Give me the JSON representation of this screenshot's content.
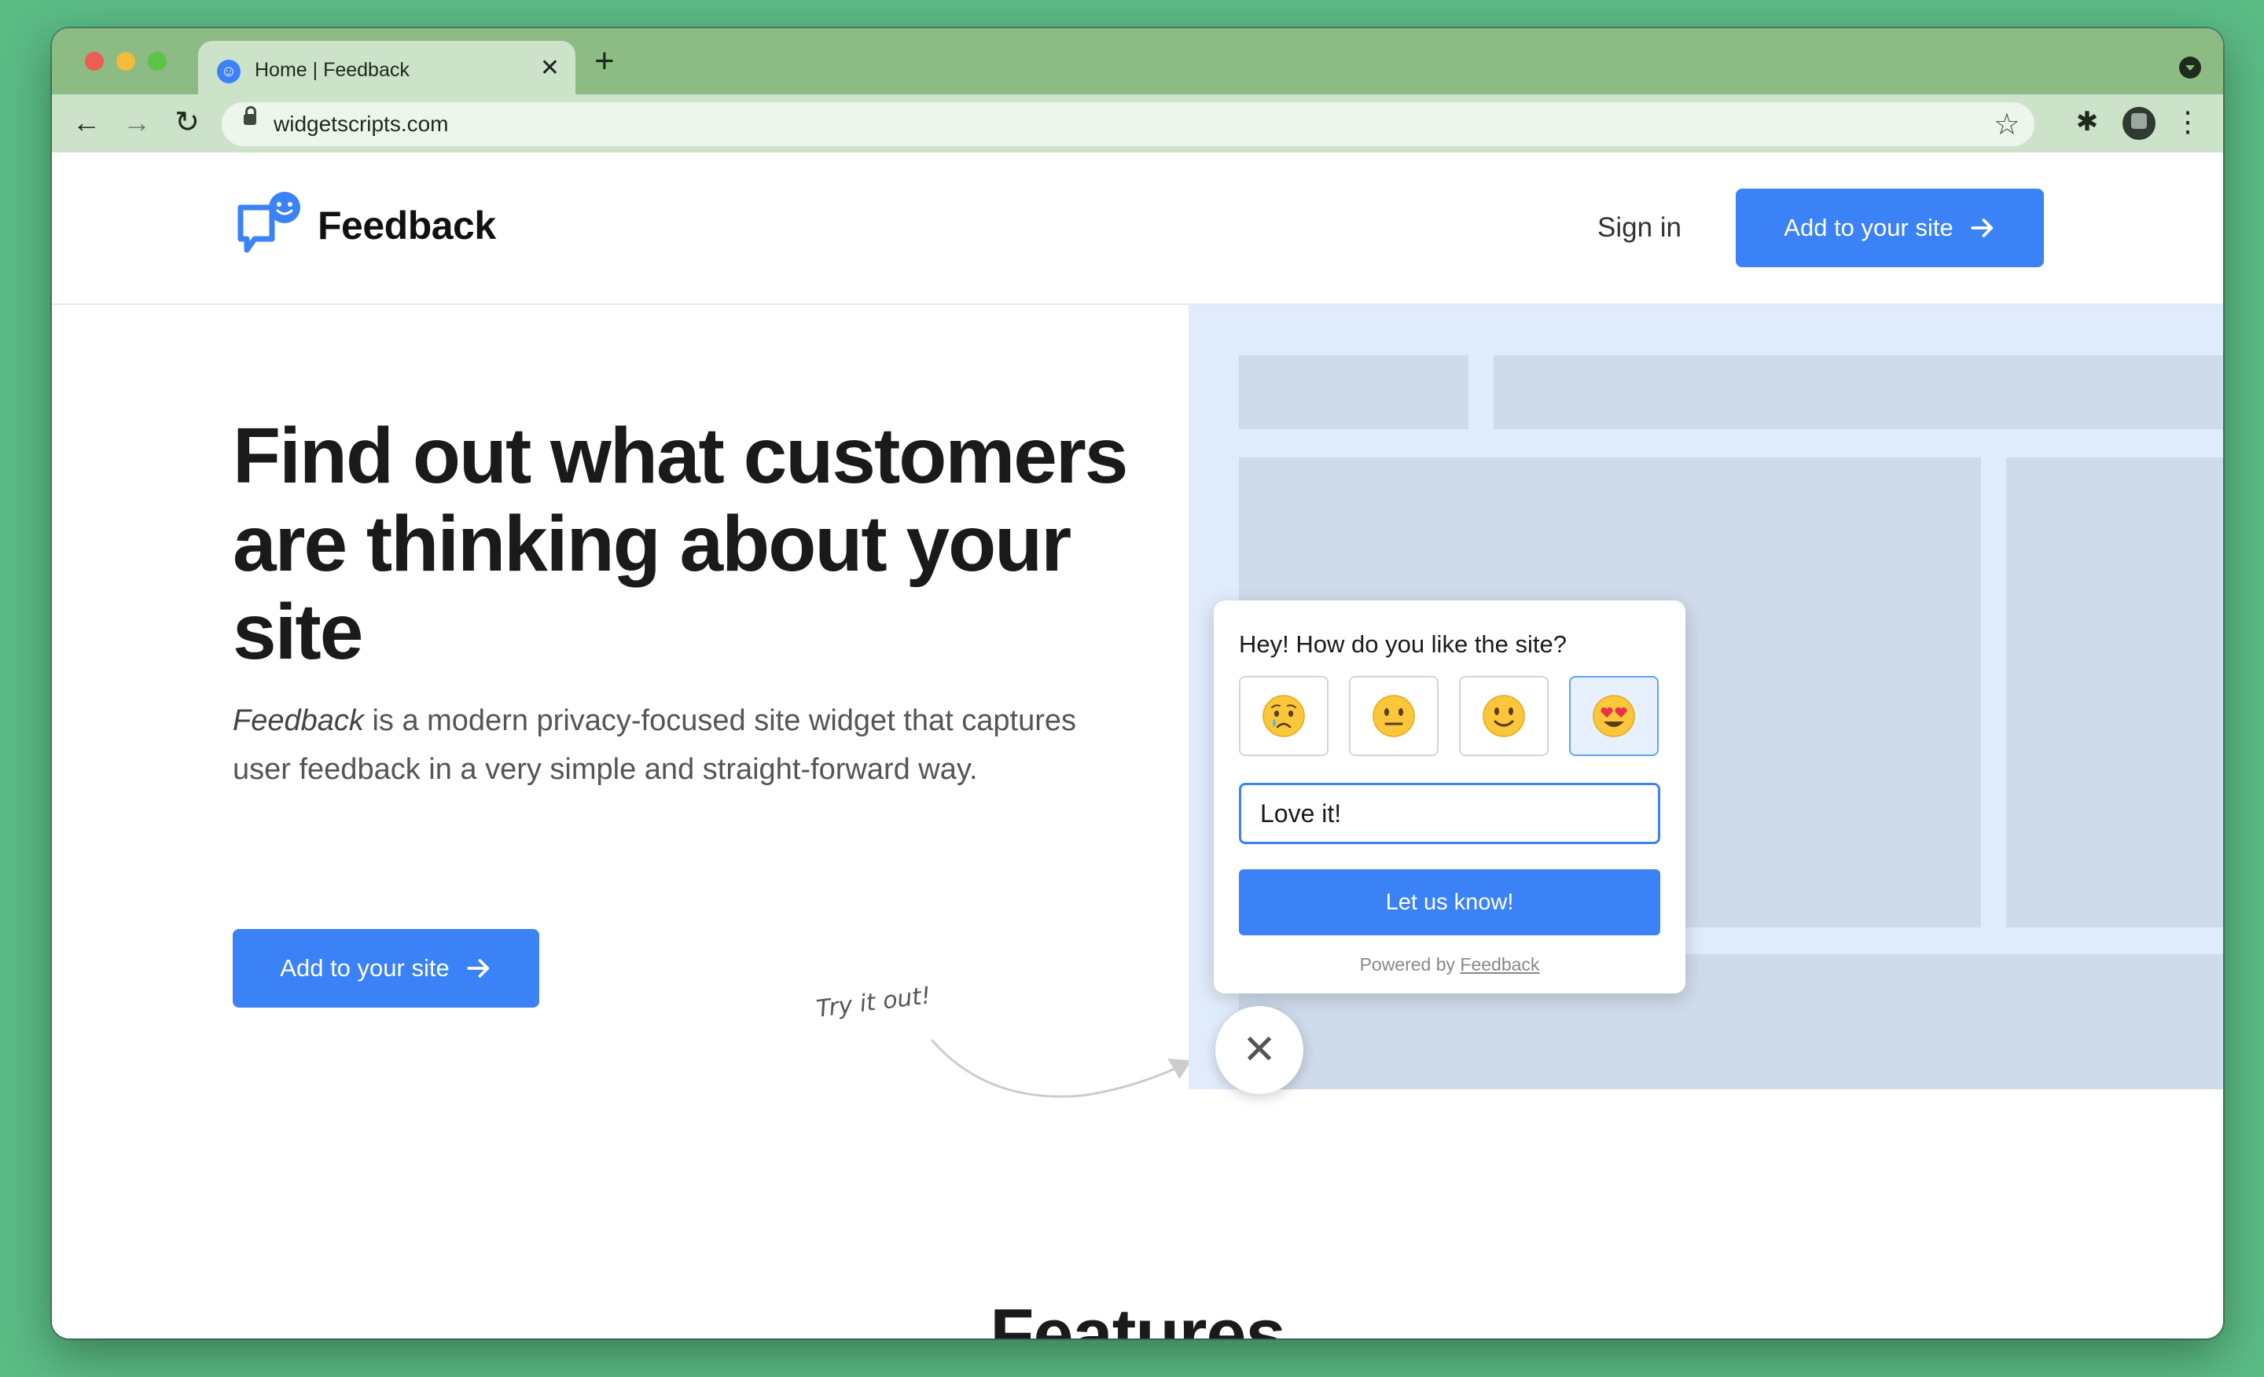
{
  "browser": {
    "tab_title": "Home | Feedback",
    "tab_close": "✕",
    "new_tab": "+",
    "url": "widgetscripts.com",
    "icons": {
      "back": "←",
      "forward": "→",
      "reload": "↻",
      "bookmark": "☆",
      "extensions": "✱",
      "menu": "⋮"
    }
  },
  "header": {
    "logo_text": "Feedback",
    "sign_in": "Sign in",
    "cta": "Add to your site"
  },
  "hero": {
    "title": "Find out what customers are thinking about your site",
    "description_brand": "Feedback",
    "description_rest": " is a modern privacy-focused site widget that captures user feedback in a very simple and straight-forward way.",
    "cta": "Add to your site",
    "try_it": "Try it out!"
  },
  "widget": {
    "question": "Hey! How do you like the site?",
    "reactions": [
      {
        "name": "crying-face-icon",
        "selected": false
      },
      {
        "name": "neutral-face-icon",
        "selected": false
      },
      {
        "name": "slightly-smiling-face-icon",
        "selected": false
      },
      {
        "name": "heart-eyes-face-icon",
        "selected": true
      }
    ],
    "comment_value": "Love it!",
    "submit": "Let us know!",
    "powered_prefix": "Powered by ",
    "powered_link": "Feedback",
    "close": "✕"
  },
  "features": {
    "heading": "Features"
  },
  "colors": {
    "accent": "#3b82f6",
    "background": "#5bbb85",
    "tabstrip": "#8cbb84",
    "mock_site": "#e0ebfb"
  }
}
